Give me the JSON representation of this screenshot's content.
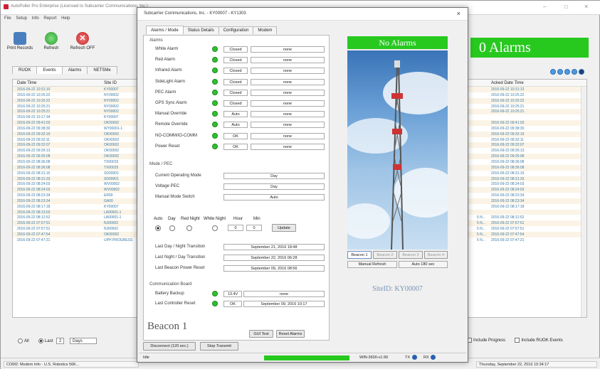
{
  "main": {
    "title": "AutoPoller Pro Enterprise (Licensed to Subcarrier Communications, Inc.)",
    "menu": [
      "File",
      "Setup",
      "Info",
      "Report",
      "Help"
    ],
    "toolbar": [
      {
        "label": "Print Records",
        "color": "#4a7fbf"
      },
      {
        "label": "Refresh",
        "color": "#3aa03a"
      },
      {
        "label": "Refresh OFF",
        "color": "#d02a2a"
      }
    ],
    "alarm_banner": "0 Alarms",
    "tabs": [
      "RUOK",
      "Events",
      "Alarms",
      "NETSMe"
    ],
    "active_tab": "Events",
    "columns": [
      "Date Time",
      "Site ID",
      "Acked Date Time"
    ],
    "rows": [
      [
        "2016-09-22 10:31:10",
        "KY00007",
        "2016-09-22 10:31:13",
        ""
      ],
      [
        "2016-09-22 10:25:22",
        "NY00002",
        "2016-09-22 10:25:22",
        ""
      ],
      [
        "2016-09-22 10:25:22",
        "NY00002",
        "2016-09-22 10:25:22",
        ""
      ],
      [
        "2016-09-22 10:25:21",
        "NY00002",
        "2016-09-22 10:25:21",
        ""
      ],
      [
        "2016-09-22 10:25:21",
        "NY00002",
        "2016-09-22 10:25:21",
        ""
      ],
      [
        "2016-09-22 10:17:34",
        "KY00007",
        "",
        ""
      ],
      [
        "2016-09-22 09:41:03",
        "OK00002",
        "2016-09-22 09:41:03",
        ""
      ],
      [
        "2016-09-22 09:38:30",
        "WT00001-1",
        "2016-09-22 09:38:30",
        ""
      ],
      [
        "2016-09-22 09:32:19",
        "OK00002",
        "2016-09-22 09:32:19",
        ""
      ],
      [
        "2016-09-22 09:32:11",
        "OK00002",
        "2016-09-22 09:32:11",
        ""
      ],
      [
        "2016-09-22 09:32:07",
        "OK00002",
        "2016-09-22 09:32:07",
        ""
      ],
      [
        "2016-09-22 09:26:13",
        "OK00002",
        "2016-09-22 09:26:13",
        ""
      ],
      [
        "2016-09-22 09:26:08",
        "OK00002",
        "2016-09-22 09:26:08",
        ""
      ],
      [
        "2016-09-22 08:36:08",
        "TX00015",
        "2016-09-22 08:36:08",
        ""
      ],
      [
        "2016-09-22 08:36:08",
        "TX00015",
        "2016-09-22 08:36:08",
        ""
      ],
      [
        "2016-09-22 08:31:15",
        "SD00001",
        "2016-09-22 08:31:15",
        ""
      ],
      [
        "2016-09-22 08:31:33",
        "SD00001",
        "2016-09-22 08:31:33",
        ""
      ],
      [
        "2016-09-22 08:24:03",
        "WV00002",
        "2016-09-22 08:24:03",
        ""
      ],
      [
        "2016-09-22 08:24:03",
        "WV00002",
        "2016-09-22 08:24:03",
        ""
      ],
      [
        "2016-09-22 08:23:34",
        "ER00",
        "2016-09-22 08:23:34",
        ""
      ],
      [
        "2016-09-22 08:23:34",
        "GA00",
        "2016-09-22 08:23:34",
        ""
      ],
      [
        "2016-09-22 08:17:18",
        "KY00007",
        "2016-09-22 08:17:18",
        ""
      ],
      [
        "2016-09-22 08:13:03",
        "LA00001-1",
        "",
        ""
      ],
      [
        "2016-09-22 08:12:52",
        "LA00001-1",
        "2016-09-22 08:12:52",
        "5 N..."
      ],
      [
        "2016-09-22 07:57:51",
        "NJ00002",
        "2016-09-22 07:57:51",
        "5 N..."
      ],
      [
        "2016-09-22 07:57:51",
        "NJ00002",
        "2016-09-22 07:57:51",
        "5 N..."
      ],
      [
        "2016-09-22 07:47:54",
        "OK00002",
        "2016-09-22 07:47:54",
        "5 N..."
      ],
      [
        "2016-09-22 07:47:21",
        "UPH PROGRESS",
        "2016-09-22 07:47:21",
        "5 N..."
      ]
    ],
    "bottom": {
      "all": "All",
      "last": "Last",
      "count": "2",
      "unit": "Days",
      "include_progress": "Include Progress",
      "include_ruok": "Include RUOK Events"
    },
    "status": {
      "left": "COM2: Modem Info - U.S. Robotics 56K...",
      "right": "Thursday, September 22, 2016 10:34:17"
    }
  },
  "dialog": {
    "title": "Subcarrier Communications, Inc. - KY00007 - KY1303",
    "close": "×",
    "tabs": [
      "Alarms / Mode",
      "Status Details",
      "Configuration",
      "Modem"
    ],
    "active_tab": "Alarms / Mode",
    "alarms_section": "Alarms",
    "alarms": [
      {
        "name": "White Alarm",
        "state": "Closed",
        "value": "none"
      },
      {
        "name": "Red Alarm",
        "state": "Closed",
        "value": "none"
      },
      {
        "name": "Infrared Alarm",
        "state": "Closed",
        "value": "none"
      },
      {
        "name": "SideLight Alarm",
        "state": "Closed",
        "value": "none"
      },
      {
        "name": "PEC Alarm",
        "state": "Closed",
        "value": "none"
      },
      {
        "name": "GPS Sync Alarm",
        "state": "Closed",
        "value": "none"
      },
      {
        "name": "Manual Override",
        "state": "Auto",
        "value": "none"
      },
      {
        "name": "Remote Override",
        "state": "Auto",
        "value": "none"
      },
      {
        "name": "NO-COMM/IO-COMM",
        "state": "OK",
        "value": "none"
      },
      {
        "name": "Power Reset",
        "state": "OK",
        "value": "none"
      }
    ],
    "mode_section": "Mode / PEC",
    "mode": [
      {
        "name": "Current Operating Mode",
        "value": "Day"
      },
      {
        "name": "Voltage PEC",
        "value": "Day"
      },
      {
        "name": "Manual Mode Switch",
        "value": "Auto"
      }
    ],
    "radios": [
      "Auto",
      "Day",
      "Red Night",
      "White Night"
    ],
    "hour_label": "Hour",
    "min_label": "Min",
    "hour": "0",
    "min": "0",
    "update": "Update",
    "transitions": [
      {
        "name": "Last Day / Night Transition",
        "value": "September 21, 2016 18:48"
      },
      {
        "name": "Last Night / Day Transition",
        "value": "September 22, 2016 06:28"
      },
      {
        "name": "Last Beacon Power Reset",
        "value": "September 09, 2016 08:56"
      }
    ],
    "comm_section": "Communication Board",
    "battery": {
      "name": "Battery Backup",
      "value": "13.4V",
      "extra": "none"
    },
    "reset": {
      "name": "Last Controller Reset",
      "value": "OK",
      "extra": "September 09, 2016 10:17"
    },
    "beacon_label": "Beacon 1",
    "gui_test": "GUI Test",
    "reset_alarms": "Reset Alarms",
    "disconnect": "Disconnect (120 sec.)",
    "stop_transmit": "Stop Transmit",
    "no_alarms": "No Alarms",
    "beacon_tabs": [
      "Beacon 1",
      "Beacon 2",
      "Beacon 3",
      "Beacon 4"
    ],
    "manual_refresh": "Manual Refresh",
    "auto_refresh": "Auto 180 sec",
    "site_id": "SiteID: KY00007",
    "status_left": "Idle",
    "status_mid": "WIN-3600-v1.90",
    "tx": "TX",
    "rx": "RX"
  },
  "colors": {
    "accent_green": "#27c91f",
    "link_blue": "#3a7aa8"
  }
}
